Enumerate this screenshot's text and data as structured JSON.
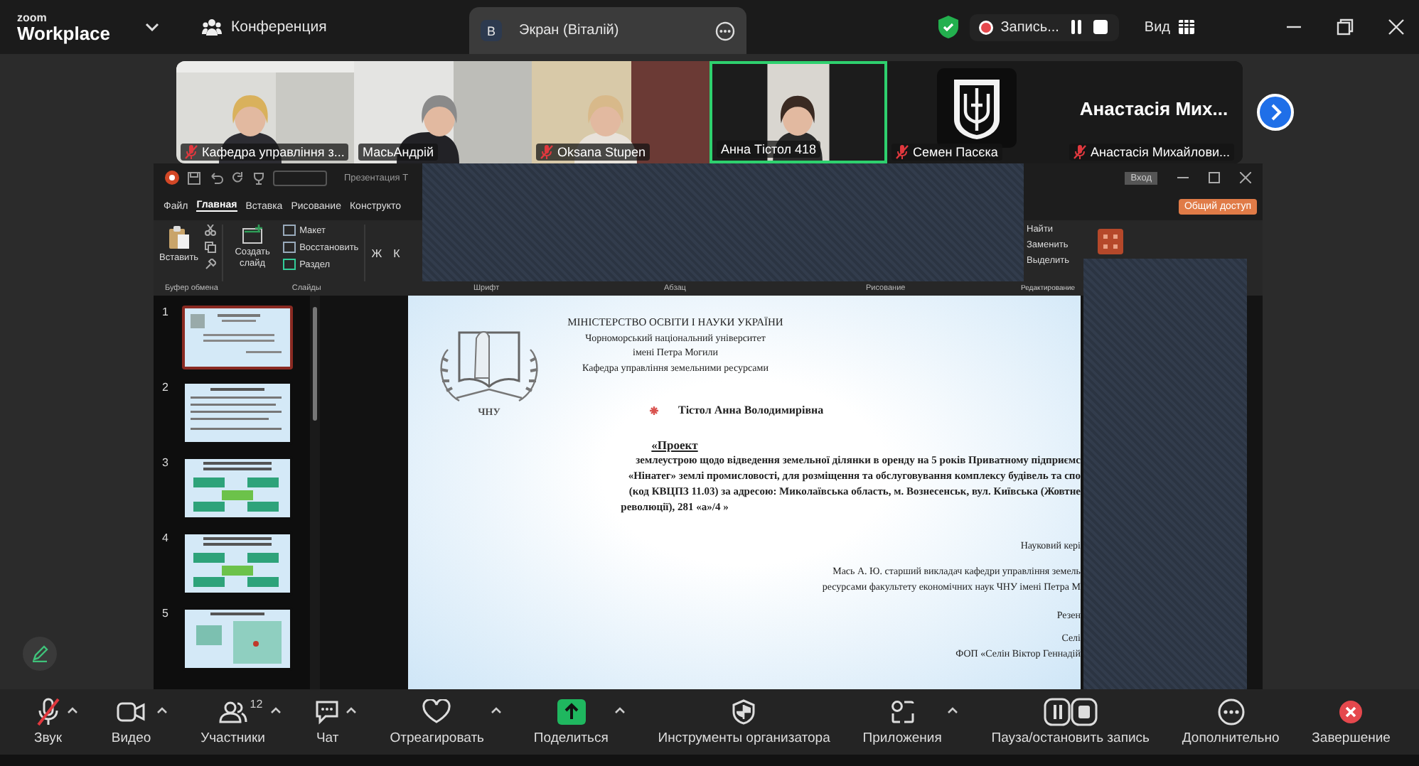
{
  "top_bar": {
    "logo_small": "zoom",
    "logo": "Workplace",
    "meeting": "Конференция",
    "tabs": [
      {
        "avatar": "В",
        "label": "Экран (Віталій)",
        "selected": true
      }
    ],
    "recording": {
      "label": "Запись...",
      "on": true
    },
    "view": "Вид"
  },
  "participants": [
    {
      "kind": "video",
      "name": "Кафедра управління з...",
      "muted": true,
      "speaking": false
    },
    {
      "kind": "video",
      "name": "МасьАндрій",
      "muted": false,
      "speaking": false
    },
    {
      "kind": "video",
      "name": "Oksana Stupen",
      "muted": true,
      "speaking": false
    },
    {
      "kind": "video",
      "name": "Анна Тістол 418",
      "muted": false,
      "speaking": true
    },
    {
      "kind": "avatar",
      "name": "Семен Пасєка",
      "muted": true,
      "speaking": false
    },
    {
      "kind": "name",
      "big_name": "Анастасія Мих...",
      "name": "Анастасія Михайлови...",
      "muted": true,
      "speaking": false
    }
  ],
  "ppt": {
    "title": "Презентация Т",
    "signin": "Вход",
    "share": "Общий доступ",
    "tabs": [
      {
        "label": "Файл",
        "selected": false
      },
      {
        "label": "Главная",
        "selected": true
      },
      {
        "label": "Вставка",
        "selected": false
      },
      {
        "label": "Рисование",
        "selected": false
      },
      {
        "label": "Конструкто",
        "selected": false
      }
    ],
    "paste": "Вставить",
    "new_slide": "Создать слайд",
    "layout": "Макет",
    "reset": "Восстановить",
    "section": "Раздел",
    "font_buttons": [
      "Ж",
      "К"
    ],
    "editing": [
      "Найти",
      "Заменить",
      "Выделить"
    ],
    "group_labels_left": [
      "Буфер обмена",
      "Слайды"
    ],
    "group_labels_middle": [
      "Шрифт",
      "Абзац",
      "Рисование"
    ],
    "group_label_right": "Редактирование",
    "thumbnails": [
      {
        "number": "1",
        "kind": "title",
        "selected": true
      },
      {
        "number": "2",
        "kind": "text",
        "selected": false
      },
      {
        "number": "3",
        "kind": "diagram",
        "selected": false
      },
      {
        "number": "4",
        "kind": "diagram",
        "selected": false
      },
      {
        "number": "5",
        "kind": "map",
        "selected": false
      }
    ],
    "slide": {
      "logo_text": "ЧНУ",
      "header": [
        "МІНІСТЕРСТВО ОСВІТИ І НАУКИ УКРАЇНИ",
        "Чорноморський національний університет",
        "імені Петра Могили",
        "Кафедра управління земельними ресурсами"
      ],
      "author": "Тістол Анна Володимирівна",
      "title": "«Проект",
      "body": [
        "землеустрою щодо відведення земельної ділянки в оренду на 5 років Приватному підприємс",
        "«Нінатег» землі промисловості, для розміщення та обслуговування комплексу будівель та спо",
        "(код КВЦПЗ 11.03) за адресою: Миколаївська область, м. Вознесенськ, вул. Київська (Жовтне"
      ],
      "body_end": "революції), 281 «а»/4 »",
      "right_lines": [
        "Науковий кері",
        "Мась А. Ю. старший викладач кафедри управління земель",
        "ресурсами факультету економічних наук ЧНУ імені Петра М",
        "Резен",
        "Селі",
        "ФОП «Селін  Віктор Геннадій"
      ]
    }
  },
  "toolbar": [
    {
      "kind": "audio",
      "label": "Звук",
      "caret": true,
      "muted": true
    },
    {
      "kind": "video",
      "label": "Видео",
      "caret": true
    },
    {
      "kind": "participants",
      "label": "Участники",
      "caret": true,
      "count": "12"
    },
    {
      "kind": "chat",
      "label": "Чат",
      "caret": true
    },
    {
      "kind": "react",
      "label": "Отреагировать",
      "caret": true
    },
    {
      "kind": "share",
      "label": "Поделиться",
      "caret": true
    },
    {
      "kind": "host",
      "label": "Инструменты организатора",
      "caret": false
    },
    {
      "kind": "apps",
      "label": "Приложения",
      "caret": true
    },
    {
      "kind": "record",
      "label": "Пауза/остановить запись",
      "caret": false
    },
    {
      "kind": "more",
      "label": "Дополнительно",
      "caret": false
    },
    {
      "kind": "end",
      "label": "Завершение",
      "caret": false
    }
  ]
}
